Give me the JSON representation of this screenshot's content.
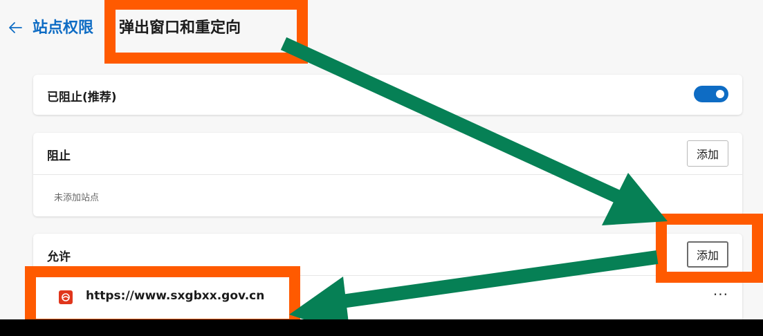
{
  "header": {
    "back_icon": "arrow-left-icon",
    "breadcrumb_parent": "站点权限",
    "page_title": "弹出窗口和重定向"
  },
  "blocked_setting": {
    "label": "已阻止(推荐)",
    "toggle_on": true,
    "accent": "#0e6cc4"
  },
  "block_section": {
    "title": "阻止",
    "add_label": "添加",
    "empty_text": "未添加站点"
  },
  "allow_section": {
    "title": "允许",
    "add_label": "添加",
    "sites": [
      {
        "url": "https://www.sxgbxx.gov.cn",
        "more_label": "···",
        "favicon_icon": "site-favicon-icon"
      }
    ]
  },
  "annotation": {
    "highlight_color": "#ff5a00",
    "arrow_color": "#068055"
  }
}
